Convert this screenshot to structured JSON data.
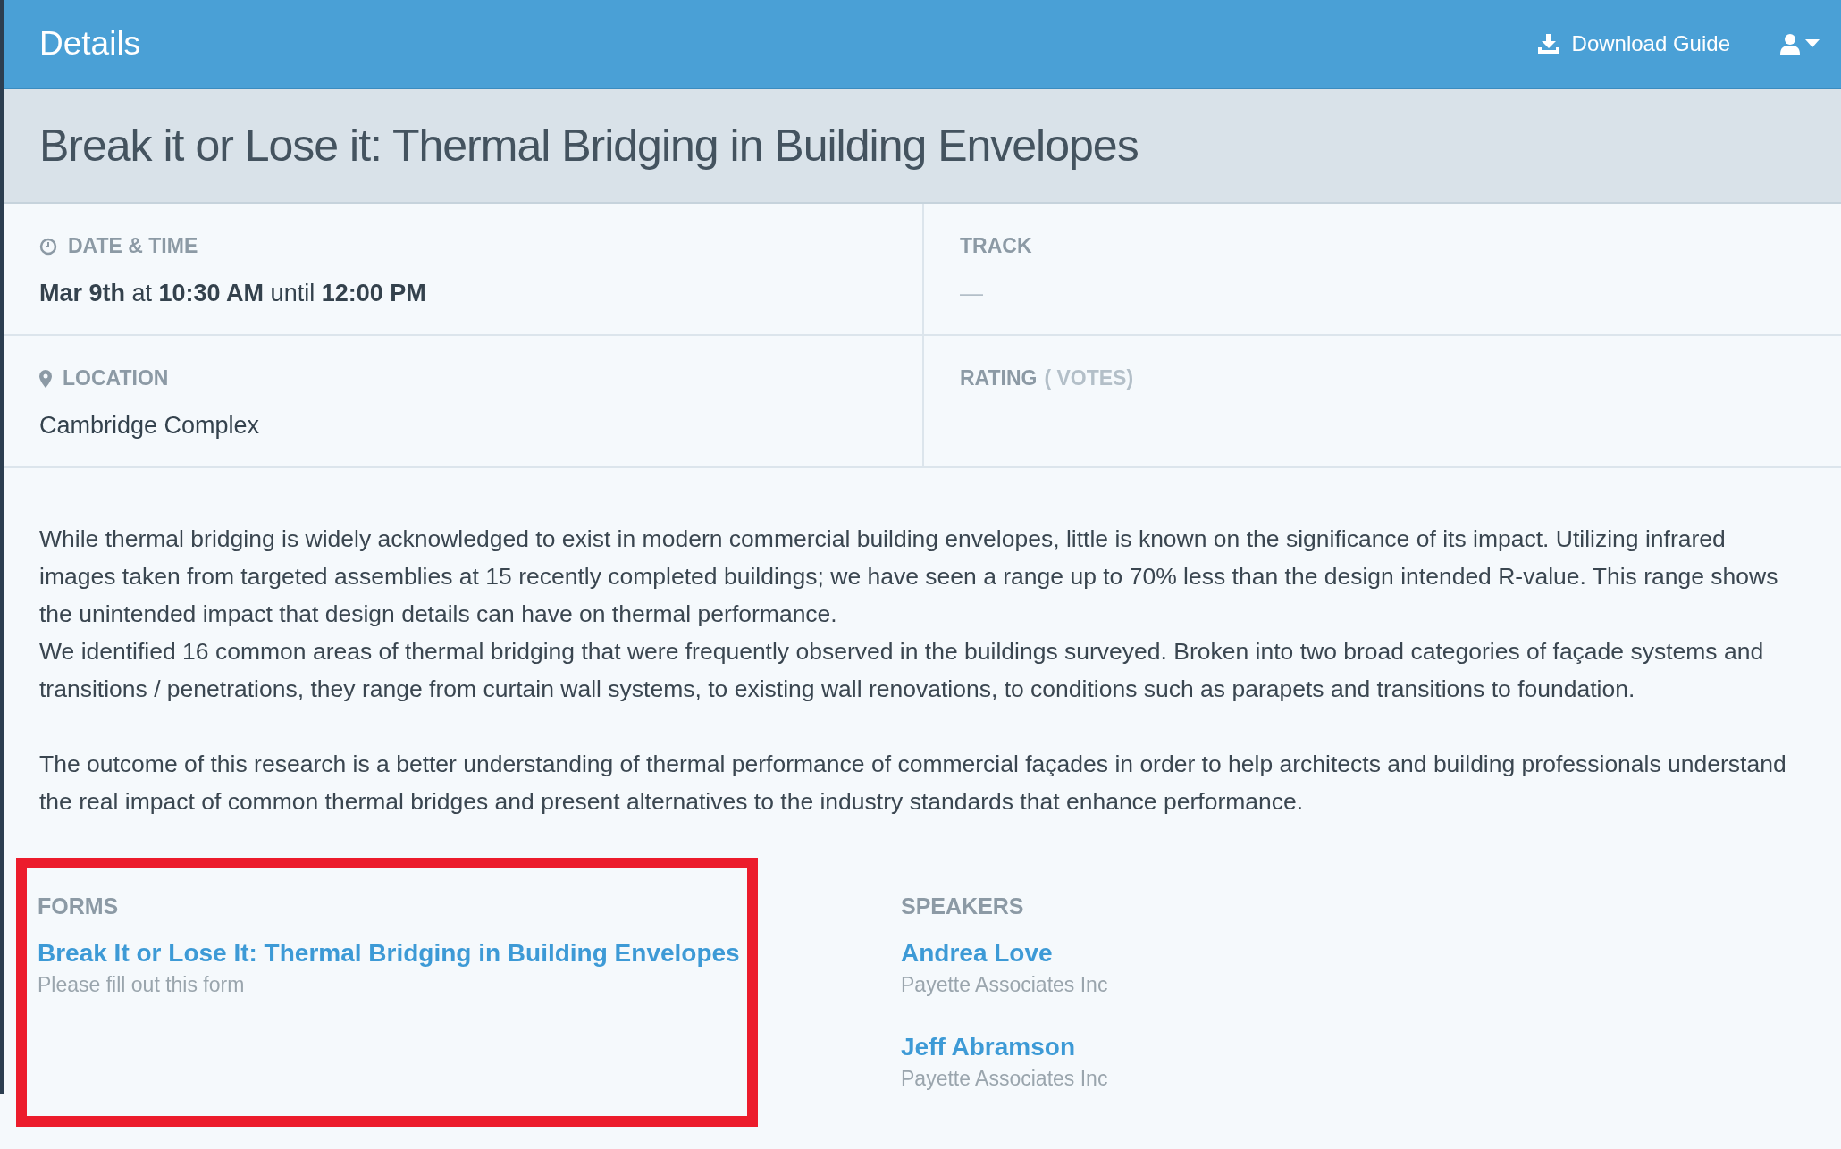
{
  "header": {
    "title": "Details",
    "download_label": "Download Guide"
  },
  "session_title": "Break it or Lose it: Thermal Bridging in Building Envelopes",
  "date_time": {
    "label": "DATE & TIME",
    "value": "**Mar 9th** at **10:30 AM** until **12:00 PM**"
  },
  "track": {
    "label": "TRACK",
    "value": "—"
  },
  "location": {
    "label": "LOCATION",
    "value": "Cambridge Complex"
  },
  "rating": {
    "label": "RATING",
    "sub": "( VOTES)"
  },
  "description": [
    [
      "While thermal bridging is widely acknowledged to exist in modern commercial building envelopes, little is known on the significance of its impact. Utilizing infrared images taken from targeted assemblies at 15 recently completed buildings; we have seen a range up to 70% less than the design intended R-value. This range shows the unintended impact that design details can have on thermal performance.",
      "We identified 16 common areas of thermal bridging that were frequently observed in the buildings surveyed. Broken into two broad categories of façade systems and transitions / penetrations, they range from curtain wall systems, to existing wall renovations, to conditions such as parapets and transitions to foundation."
    ],
    [
      "The outcome of this research is a better understanding of thermal performance of commercial façades in order to help architects and building professionals understand the real impact of common thermal bridges and present alternatives to the industry standards that enhance performance."
    ]
  ],
  "forms": {
    "heading": "FORMS",
    "highlighted": true,
    "items": [
      {
        "title": "Break It or Lose It: Thermal Bridging in Building Envelopes",
        "note": "Please fill out this form"
      }
    ]
  },
  "speakers": {
    "heading": "SPEAKERS",
    "items": [
      {
        "name": "Andrea Love",
        "company": "Payette Associates Inc"
      },
      {
        "name": "Jeff Abramson",
        "company": "Payette Associates Inc"
      }
    ]
  }
}
